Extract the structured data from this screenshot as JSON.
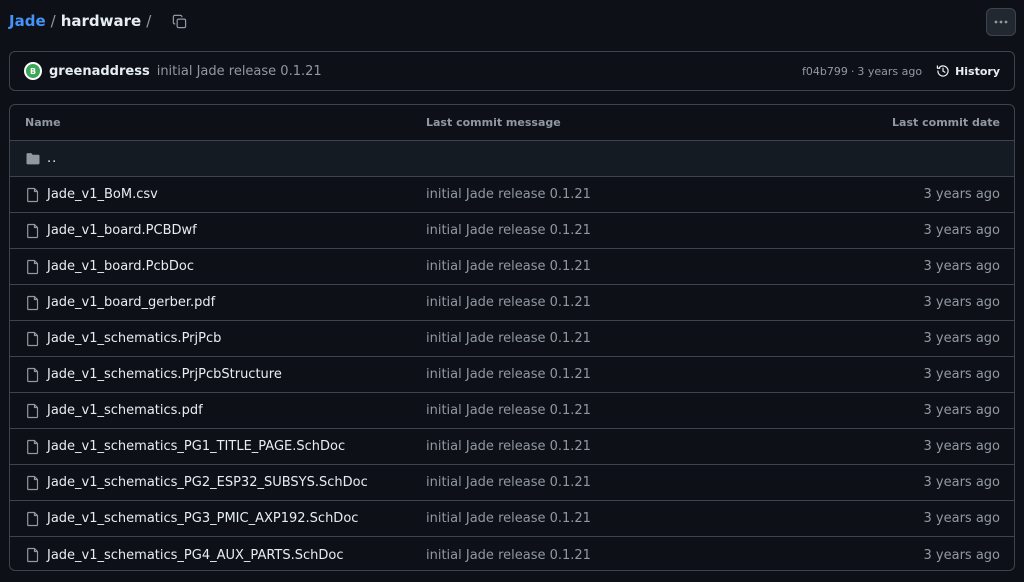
{
  "breadcrumb": {
    "repo": "Jade",
    "separator": "/",
    "current": "hardware",
    "trailing_separator": "/"
  },
  "commit": {
    "author": "greenaddress",
    "message": "initial Jade release 0.1.21",
    "sha": "f04b799",
    "dot": "·",
    "age": "3 years ago",
    "history_label": "History",
    "avatar_letter": "B"
  },
  "table": {
    "headers": {
      "name": "Name",
      "message": "Last commit message",
      "date": "Last commit date"
    },
    "parent_label": "..",
    "rows": [
      {
        "name": "Jade_v1_BoM.csv",
        "message": "initial Jade release 0.1.21",
        "date": "3 years ago"
      },
      {
        "name": "Jade_v1_board.PCBDwf",
        "message": "initial Jade release 0.1.21",
        "date": "3 years ago"
      },
      {
        "name": "Jade_v1_board.PcbDoc",
        "message": "initial Jade release 0.1.21",
        "date": "3 years ago"
      },
      {
        "name": "Jade_v1_board_gerber.pdf",
        "message": "initial Jade release 0.1.21",
        "date": "3 years ago"
      },
      {
        "name": "Jade_v1_schematics.PrjPcb",
        "message": "initial Jade release 0.1.21",
        "date": "3 years ago"
      },
      {
        "name": "Jade_v1_schematics.PrjPcbStructure",
        "message": "initial Jade release 0.1.21",
        "date": "3 years ago"
      },
      {
        "name": "Jade_v1_schematics.pdf",
        "message": "initial Jade release 0.1.21",
        "date": "3 years ago"
      },
      {
        "name": "Jade_v1_schematics_PG1_TITLE_PAGE.SchDoc",
        "message": "initial Jade release 0.1.21",
        "date": "3 years ago"
      },
      {
        "name": "Jade_v1_schematics_PG2_ESP32_SUBSYS.SchDoc",
        "message": "initial Jade release 0.1.21",
        "date": "3 years ago"
      },
      {
        "name": "Jade_v1_schematics_PG3_PMIC_AXP192.SchDoc",
        "message": "initial Jade release 0.1.21",
        "date": "3 years ago"
      },
      {
        "name": "Jade_v1_schematics_PG4_AUX_PARTS.SchDoc",
        "message": "initial Jade release 0.1.21",
        "date": "3 years ago"
      }
    ]
  },
  "icons": {
    "copy": "copy-icon",
    "more": "kebab-horizontal-icon",
    "history": "history-icon",
    "folder": "folder-icon",
    "file": "file-icon"
  },
  "colors": {
    "background": "#0d1117",
    "border": "#3d444d",
    "link": "#4493f8",
    "muted": "#9198a1",
    "text": "#e6edf3"
  }
}
